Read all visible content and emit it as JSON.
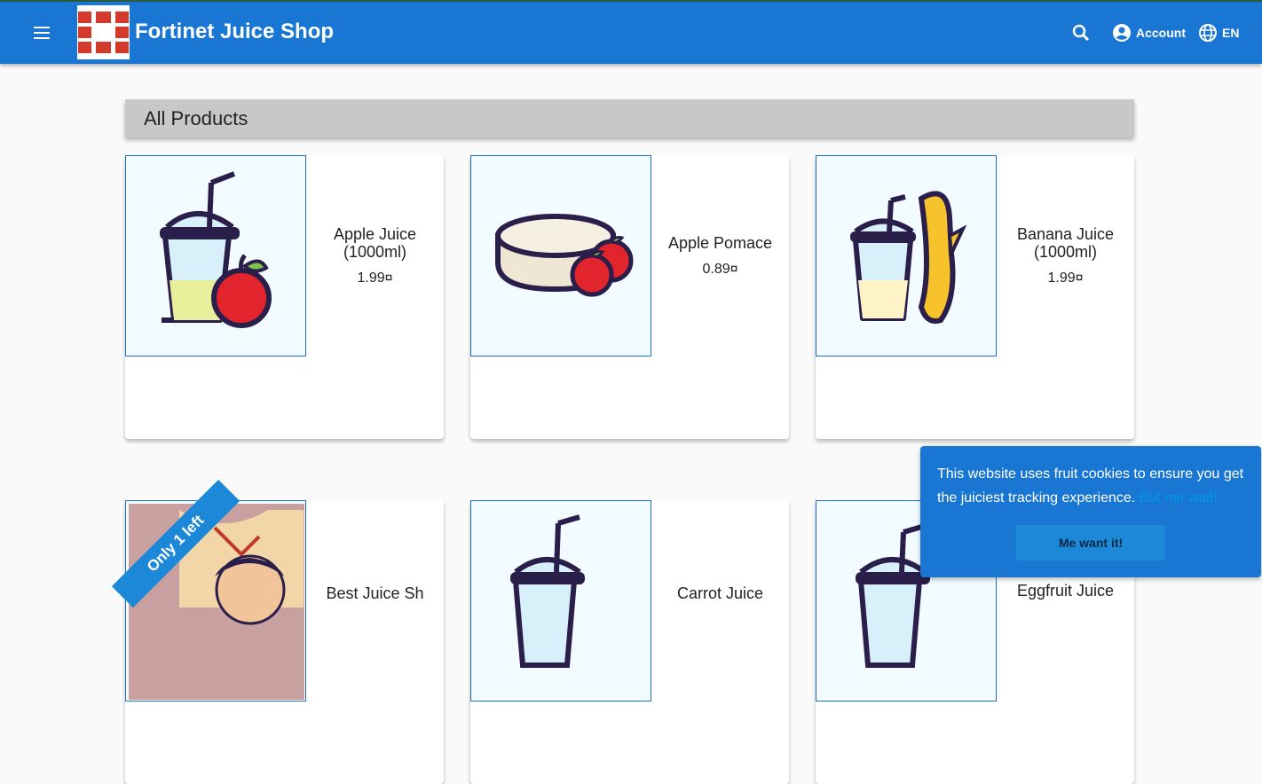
{
  "toolbar": {
    "title": "Fortinet Juice Shop",
    "account_label": "Account",
    "language_label": "EN",
    "colors": {
      "bar": "#1976d2",
      "logo_red": "#d33a2c"
    }
  },
  "main": {
    "heading": "All Products",
    "products": [
      {
        "name": "Apple Juice (1000ml)",
        "price": "1.99¤",
        "image_icon": "apple-juice-icon"
      },
      {
        "name": "Apple Pomace",
        "price": "0.89¤",
        "image_icon": "apple-pomace-icon"
      },
      {
        "name": "Banana Juice (1000ml)",
        "price": "1.99¤",
        "image_icon": "banana-juice-icon"
      },
      {
        "name": "Best Juice Sh",
        "price": "",
        "image_icon": "juice-shop-artwork",
        "badge": "Only 1 left"
      },
      {
        "name": "Carrot Juice",
        "price": "",
        "image_icon": "carrot-juice-icon"
      },
      {
        "name": "Eggfruit Juice",
        "price": "",
        "image_icon": "eggfruit-juice-icon"
      }
    ]
  },
  "cookie_banner": {
    "message": "This website uses fruit cookies to ensure you get the juiciest tracking experience.",
    "link_text": "But me wait!",
    "accept_label": "Me want it!"
  }
}
